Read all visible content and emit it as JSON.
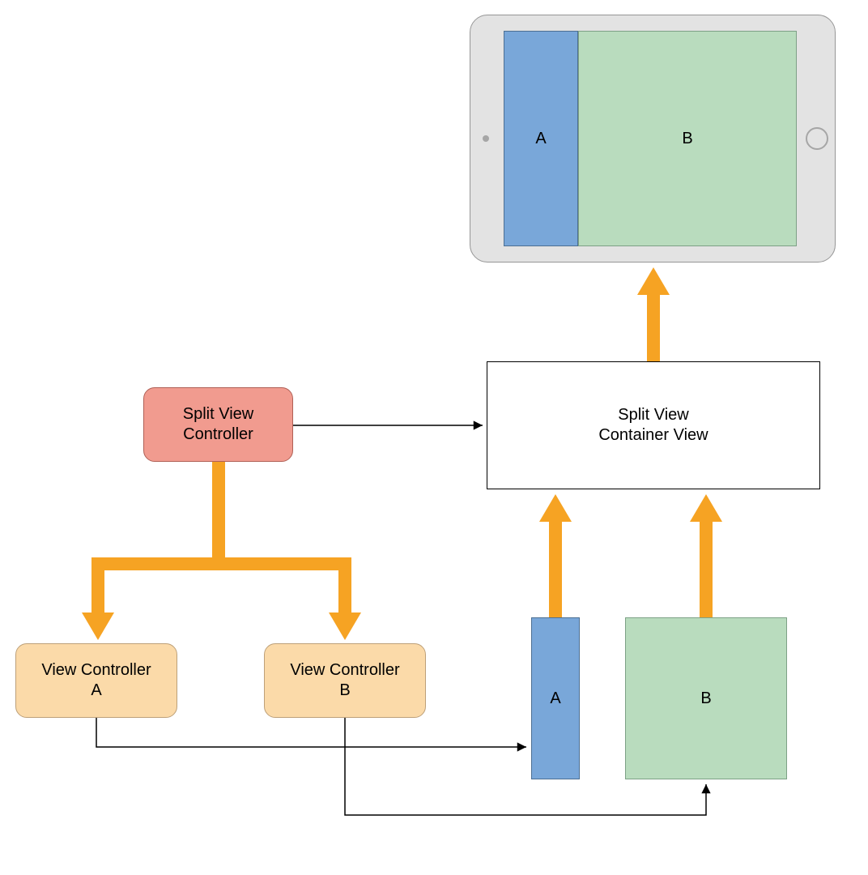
{
  "colors": {
    "coral_fill": "#F19B8F",
    "coral_stroke": "#B06056",
    "peach_fill": "#FBDAA9",
    "peach_stroke": "#BDA079",
    "blue_fill": "#79A7D9",
    "blue_stroke": "#4C6F93",
    "green_fill": "#B9DCBE",
    "green_stroke": "#7DA186",
    "orange": "#F6A323",
    "black": "#000000",
    "ipad_frame": "#E3E3E3",
    "ipad_stroke": "#969696",
    "white": "#ffffff"
  },
  "nodes": {
    "split_view_controller": "Split View\nController",
    "view_controller_a": "View Controller\nA",
    "view_controller_b": "View Controller\nB",
    "split_view_container": "Split View\nContainer View",
    "pane_a": "A",
    "pane_b": "B",
    "ipad_a": "A",
    "ipad_b": "B"
  }
}
